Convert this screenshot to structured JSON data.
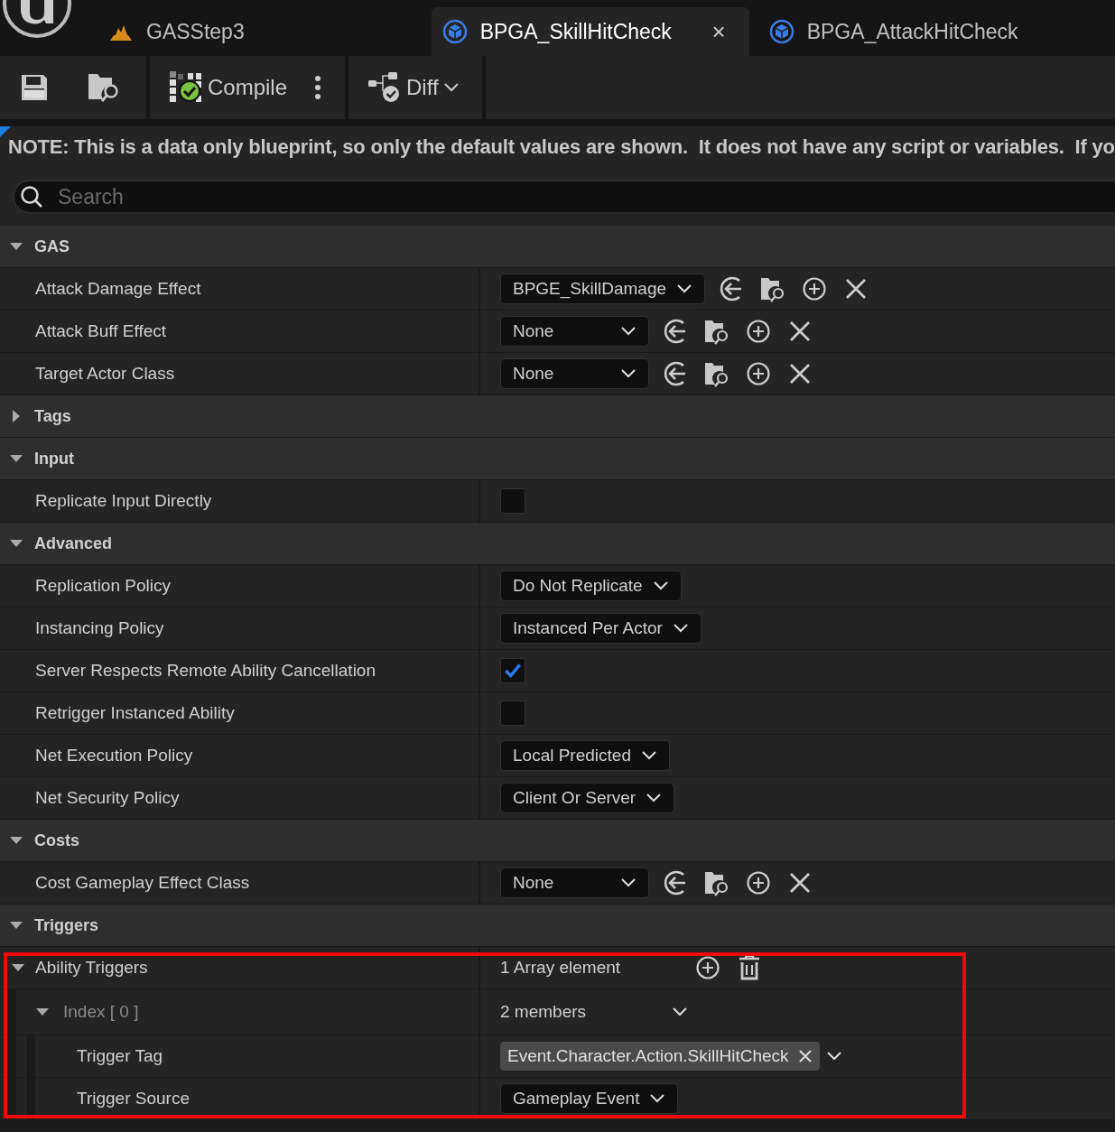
{
  "tabs": [
    {
      "label": "GASStep3",
      "kind": "level",
      "selected": false,
      "closable": false
    },
    {
      "label": "BPGA_SkillHitCheck",
      "kind": "blueprint",
      "selected": true,
      "closable": true,
      "close_glyph": "×"
    },
    {
      "label": "BPGA_AttackHitCheck",
      "kind": "blueprint",
      "selected": false,
      "closable": false
    }
  ],
  "toolbar": {
    "compile": "Compile",
    "diff": "Diff"
  },
  "note": "NOTE: This is a data only blueprint, so only the default values are shown.  It does not have any script or variables.  If yo",
  "search": {
    "placeholder": "Search"
  },
  "sections": [
    {
      "title": "GAS",
      "expanded": true,
      "rows": [
        {
          "label": "Attack Damage Effect",
          "kind": "asset",
          "value": "BPGE_SkillDamage"
        },
        {
          "label": "Attack Buff Effect",
          "kind": "asset",
          "value": "None"
        },
        {
          "label": "Target Actor Class",
          "kind": "asset",
          "value": "None"
        }
      ]
    },
    {
      "title": "Tags",
      "expanded": false
    },
    {
      "title": "Input",
      "expanded": true,
      "rows": [
        {
          "label": "Replicate Input Directly",
          "kind": "checkbox",
          "checked": false
        }
      ]
    },
    {
      "title": "Advanced",
      "expanded": true,
      "rows": [
        {
          "label": "Replication Policy",
          "kind": "combo",
          "value": "Do Not Replicate"
        },
        {
          "label": "Instancing Policy",
          "kind": "combo",
          "value": "Instanced Per Actor"
        },
        {
          "label": "Server Respects Remote Ability Cancellation",
          "kind": "checkbox",
          "checked": true
        },
        {
          "label": "Retrigger Instanced Ability",
          "kind": "checkbox",
          "checked": false
        },
        {
          "label": "Net Execution Policy",
          "kind": "combo",
          "value": "Local Predicted"
        },
        {
          "label": "Net Security Policy",
          "kind": "combo",
          "value": "Client Or Server"
        }
      ]
    },
    {
      "title": "Costs",
      "expanded": true,
      "rows": [
        {
          "label": "Cost Gameplay Effect Class",
          "kind": "asset",
          "value": "None"
        }
      ]
    },
    {
      "title": "Triggers",
      "expanded": true,
      "rows": [
        {
          "label": "Ability Triggers",
          "kind": "array",
          "value": "1 Array element",
          "expanded": true,
          "highlighted": true,
          "children": [
            {
              "label": "Index [ 0 ]",
              "kind": "struct",
              "value": "2 members",
              "expanded": true,
              "children": [
                {
                  "label": "Trigger Tag",
                  "kind": "tag",
                  "value": "Event.Character.Action.SkillHitCheck"
                },
                {
                  "label": "Trigger Source",
                  "kind": "combo",
                  "value": "Gameplay Event"
                }
              ]
            }
          ]
        }
      ]
    }
  ]
}
